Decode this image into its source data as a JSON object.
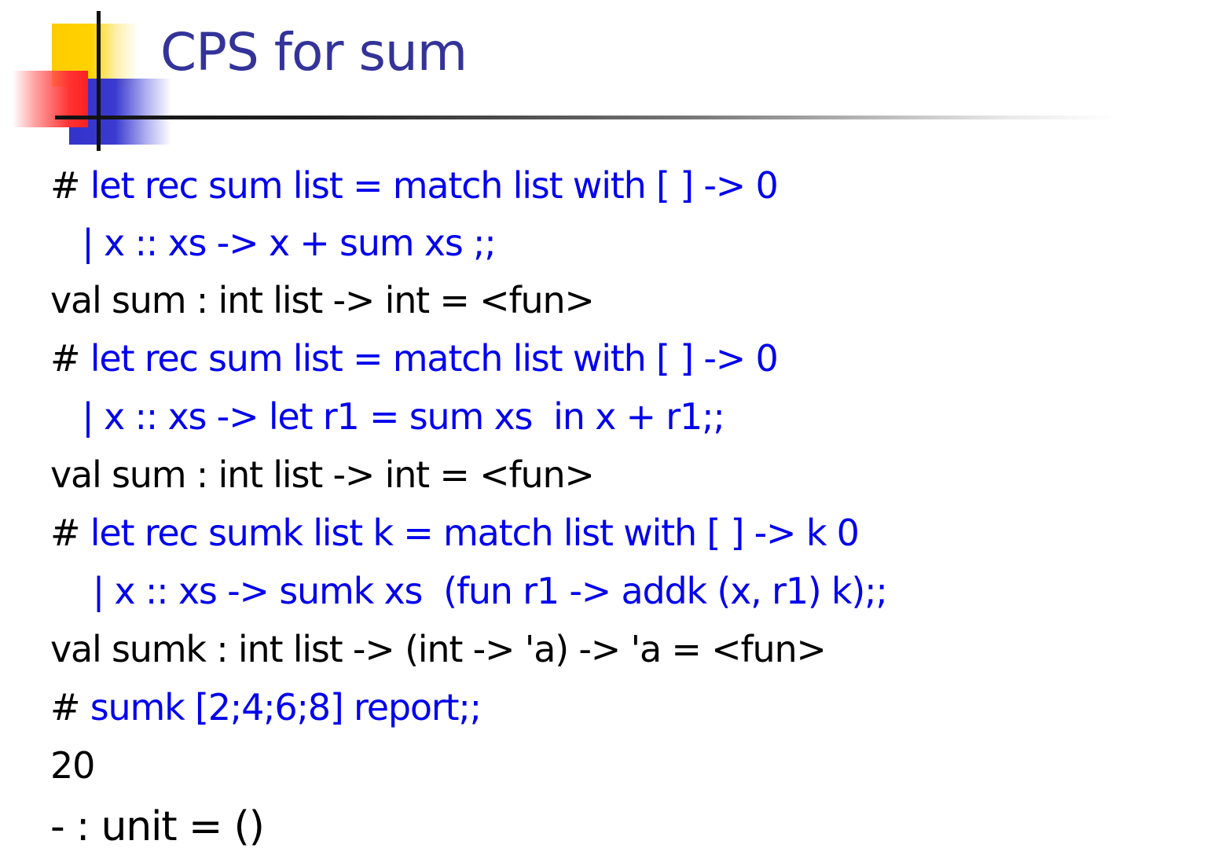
{
  "title": "CPS for sum",
  "colors": {
    "title": "#333399",
    "input": "#0000ee",
    "output": "#000000"
  },
  "lines": [
    {
      "prompt": "# ",
      "code": "let rec sum list = match list with [ ] -> 0"
    },
    {
      "prompt": "   ",
      "code": "| x :: xs -> x + sum xs ;;"
    },
    {
      "text": "val sum : int list -> int = <fun>"
    },
    {
      "prompt": "# ",
      "code": "let rec sum list = match list with [ ] -> 0"
    },
    {
      "prompt": "   ",
      "code": "| x :: xs -> let r1 = sum xs  in x + r1;;"
    },
    {
      "text": "val sum : int list -> int = <fun>"
    },
    {
      "prompt": "# ",
      "code": "let rec sumk list k = match list with [ ] -> k 0"
    },
    {
      "prompt": "    ",
      "code": "| x :: xs -> sumk xs  (fun r1 -> addk (x, r1) k);;"
    },
    {
      "text": "val sumk : int list -> (int -> 'a) -> 'a = <fun>"
    },
    {
      "prompt": "# ",
      "code": "sumk [2;4;6;8] report;;"
    },
    {
      "text": "20"
    },
    {
      "text": "- : unit = ()"
    }
  ]
}
